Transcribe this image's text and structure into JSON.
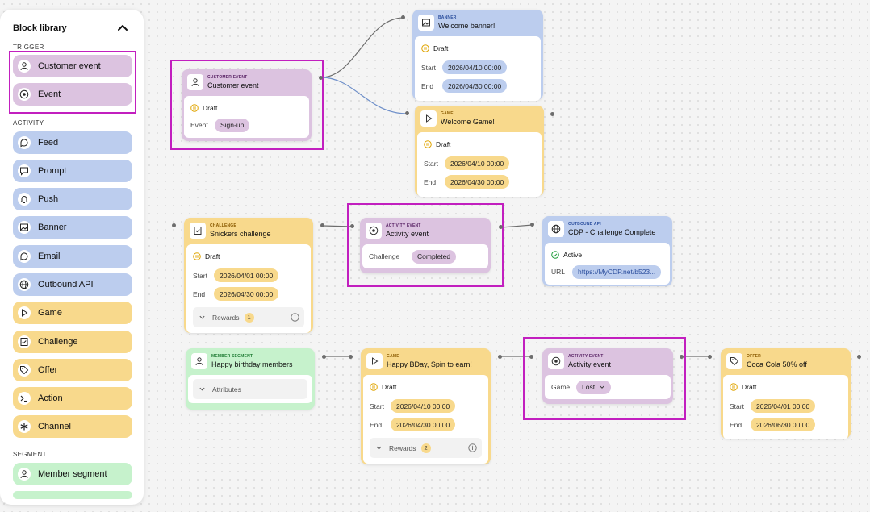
{
  "sidebar": {
    "title": "Block library",
    "sections": {
      "trigger": "TRIGGER",
      "activity": "ACTIVITY",
      "segment": "SEGMENT"
    },
    "trigger_items": [
      "Customer event",
      "Event"
    ],
    "activity_items": [
      "Feed",
      "Prompt",
      "Push",
      "Banner",
      "Email",
      "Outbound API",
      "Game",
      "Challenge",
      "Offer",
      "Action",
      "Channel"
    ],
    "segment_items": [
      "Member segment"
    ]
  },
  "nodes": {
    "customer_event": {
      "kind": "CUSTOMER EVENT",
      "title": "Customer event",
      "status": "Draft",
      "event_label": "Event",
      "event_value": "Sign-up"
    },
    "banner": {
      "kind": "BANNER",
      "title": "Welcome banner!",
      "status": "Draft",
      "start_label": "Start",
      "start": "2026/04/10 00:00",
      "end_label": "End",
      "end": "2026/04/30 00:00"
    },
    "game1": {
      "kind": "GAME",
      "title": "Welcome Game!",
      "status": "Draft",
      "start_label": "Start",
      "start": "2026/04/10 00:00",
      "end_label": "End",
      "end": "2026/04/30 00:00"
    },
    "challenge": {
      "kind": "CHALLENGE",
      "title": "Snickers challenge",
      "status": "Draft",
      "start_label": "Start",
      "start": "2026/04/01 00:00",
      "end_label": "End",
      "end": "2026/04/30 00:00",
      "rewards_label": "Rewards",
      "rewards_count": "1"
    },
    "activity1": {
      "kind": "ACTIVITY EVENT",
      "title": "Activity event",
      "field_label": "Challenge",
      "field_value": "Completed"
    },
    "outbound": {
      "kind": "OUTBOUND API",
      "title": "CDP - Challenge Complete",
      "status": "Active",
      "url_label": "URL",
      "url": "https://MyCDP.net/b523..."
    },
    "segment": {
      "kind": "MEMBER SEGMENT",
      "title": "Happy birthday members",
      "attributes_label": "Attributes"
    },
    "game2": {
      "kind": "GAME",
      "title": "Happy BDay, Spin to earn!",
      "status": "Draft",
      "start_label": "Start",
      "start": "2026/04/10 00:00",
      "end_label": "End",
      "end": "2026/04/30 00:00",
      "rewards_label": "Rewards",
      "rewards_count": "2"
    },
    "activity2": {
      "kind": "ACTIVITY EVENT",
      "title": "Activity event",
      "field_label": "Game",
      "field_value": "Lost"
    },
    "offer": {
      "kind": "OFFER",
      "title": "Coca Cola 50% off",
      "status": "Draft",
      "start_label": "Start",
      "start": "2026/04/01 00:00",
      "end_label": "End",
      "end": "2026/06/30 00:00"
    }
  },
  "colors": {
    "purple": "#dcc3e0",
    "blue": "#bccdee",
    "yellow": "#f8d98c",
    "green": "#c6f2cc",
    "highlight": "#c21fbf",
    "draft_status": "#e0a400",
    "active_status": "#1e9e3a"
  }
}
